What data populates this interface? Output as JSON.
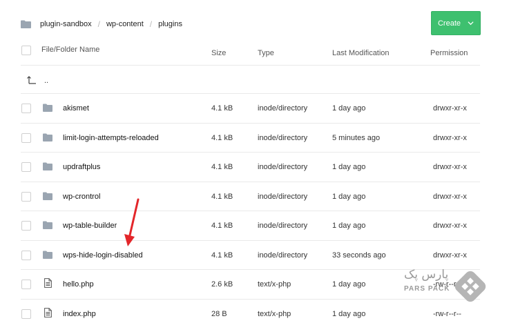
{
  "breadcrumb": [
    "plugin-sandbox",
    "wp-content",
    "plugins"
  ],
  "breadcrumb_separator": "/",
  "create_label": "Create",
  "columns": {
    "name": "File/Folder Name",
    "size": "Size",
    "type": "Type",
    "modified": "Last Modification",
    "permission": "Permission"
  },
  "parent_label": "..",
  "rows": [
    {
      "name": "akismet",
      "size": "4.1 kB",
      "type": "inode/directory",
      "modified": "1 day ago",
      "permission": "drwxr-xr-x",
      "icon": "folder-icon"
    },
    {
      "name": "limit-login-attempts-reloaded",
      "size": "4.1 kB",
      "type": "inode/directory",
      "modified": "5 minutes ago",
      "permission": "drwxr-xr-x",
      "icon": "folder-icon"
    },
    {
      "name": "updraftplus",
      "size": "4.1 kB",
      "type": "inode/directory",
      "modified": "1 day ago",
      "permission": "drwxr-xr-x",
      "icon": "folder-icon"
    },
    {
      "name": "wp-crontrol",
      "size": "4.1 kB",
      "type": "inode/directory",
      "modified": "1 day ago",
      "permission": "drwxr-xr-x",
      "icon": "folder-icon"
    },
    {
      "name": "wp-table-builder",
      "size": "4.1 kB",
      "type": "inode/directory",
      "modified": "1 day ago",
      "permission": "drwxr-xr-x",
      "icon": "folder-icon"
    },
    {
      "name": "wps-hide-login-disabled",
      "size": "4.1 kB",
      "type": "inode/directory",
      "modified": "33 seconds ago",
      "permission": "drwxr-xr-x",
      "icon": "folder-icon"
    },
    {
      "name": "hello.php",
      "size": "2.6 kB",
      "type": "text/x-php",
      "modified": "1 day ago",
      "permission": "-rw-r--r--",
      "icon": "file-icon"
    },
    {
      "name": "index.php",
      "size": "28 B",
      "type": "text/x-php",
      "modified": "1 day ago",
      "permission": "-rw-r--r--",
      "icon": "file-icon"
    }
  ],
  "watermark": {
    "text_fa": "پارس پک",
    "text_en": "PARS PACK"
  },
  "colors": {
    "accent": "#3ec06f",
    "icon": "#9aa5b1",
    "arrow": "#e3262a"
  }
}
